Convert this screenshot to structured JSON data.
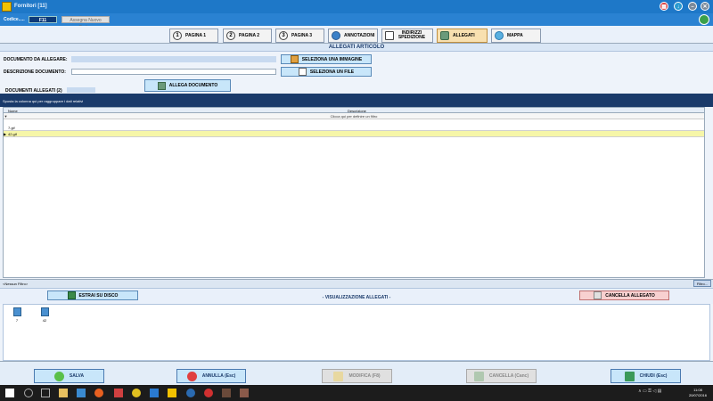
{
  "window": {
    "title": "Fornitori  [11]"
  },
  "codebar": {
    "label": "Codice.....",
    "code": "F11",
    "new_code_button": "Assegna Nuovo Codice"
  },
  "tabs": [
    {
      "label": "PAGINA 1",
      "icon": "1"
    },
    {
      "label": "PAGINA 2",
      "icon": "2"
    },
    {
      "label": "PAGINA 3",
      "icon": "3"
    },
    {
      "label": "ANNOTAZIONI",
      "icon": ""
    },
    {
      "label": "INDIRIZZI SPEDIZIONE",
      "icon": ""
    },
    {
      "label": "ALLEGATI",
      "icon": ""
    },
    {
      "label": "MAPPA",
      "icon": ""
    }
  ],
  "section": {
    "title": "ALLEGATI ARTICOLO"
  },
  "form": {
    "document_label": "DOCUMENTO DA ALLEGARE:",
    "description_label": "DESCRIZIONE DOCUMENTO:",
    "select_image_button": "SELEZIONA UNA IMMAGINE",
    "select_file_button": "SELEZIONA UN FILE",
    "attach_button": "ALLEGA DOCUMENTO",
    "attached_label": "DOCUMENTI ALLEGATI (2)"
  },
  "grid": {
    "group_hint": "Sposta la colonna qui per raggruppare i dati relativi",
    "columns": [
      "Nome",
      "Descrizione"
    ],
    "filter_hint": "Clicca qui per definire un filtro",
    "rows": [
      {
        "name": "7.gif",
        "description": ""
      },
      {
        "name": "42.gif",
        "description": ""
      }
    ],
    "no_filter": "<Nessun Filtro>",
    "filter_button": "Filtro..."
  },
  "viewer": {
    "extract_button": "ESTRAI SU DISCO",
    "title": "- VISUALIZZAZIONE ALLEGATI -",
    "delete_button": "CANCELLA ALLEGATO",
    "thumbs": [
      "7",
      "42"
    ]
  },
  "actions": {
    "save": "SALVA",
    "cancel_edit": "ANNULLA (Esc)",
    "modify": "MODIFICA (F8)",
    "delete": "CANCELLA (Canc)",
    "close": "CHIUDI (Esc)"
  },
  "taskbar": {
    "time": "11:08",
    "date": "20/07/2016"
  },
  "colors": {
    "titlebar": "#1e78c8",
    "accent": "#1a3a6a",
    "active_tab": "#f8e0b0",
    "selected_row": "#f6f6a8"
  }
}
